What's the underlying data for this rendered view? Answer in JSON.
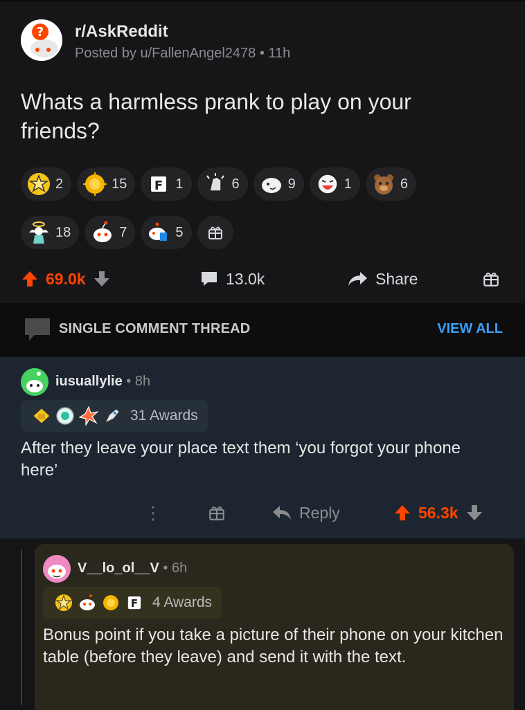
{
  "post": {
    "subreddit": "r/AskReddit",
    "meta": "Posted by u/FallenAngel2478 • 11h",
    "title": "Whats a harmless prank to play on your friends?",
    "awards_row1": [
      {
        "icon": "helpful-star-award-icon",
        "count": "2"
      },
      {
        "icon": "gold-award-icon",
        "count": "15"
      },
      {
        "icon": "press-f-award-icon",
        "count": "1"
      },
      {
        "icon": "clapping-hands-award-icon",
        "count": "6"
      },
      {
        "icon": "face-award-icon",
        "count": "9"
      },
      {
        "icon": "laughing-award-icon",
        "count": "1"
      },
      {
        "icon": "bear-award-icon",
        "count": "6"
      }
    ],
    "awards_row2": [
      {
        "icon": "angel-award-icon",
        "count": "18"
      },
      {
        "icon": "snoo-award-icon",
        "count": "7"
      },
      {
        "icon": "hugs-award-icon",
        "count": "5"
      }
    ],
    "upvotes": "69.0k",
    "comments": "13.0k",
    "share_label": "Share"
  },
  "thread": {
    "title": "SINGLE COMMENT THREAD",
    "view_all": "VIEW ALL"
  },
  "comment1": {
    "user": "iusuallylie",
    "time": " • 8h",
    "awards_label": "31 Awards",
    "body": "After they leave your place text them ‘you forgot your phone here’",
    "more_label": "⋮",
    "reply_label": "Reply",
    "upvotes": "56.3k"
  },
  "comment2": {
    "user": "V__lo_ol__V",
    "time": " • 6h",
    "awards_label": "4 Awards",
    "body": "Bonus point if you take a picture of their phone on your kitchen table (before they leave) and send it with the text."
  },
  "colors": {
    "accent_orange": "#ff4500",
    "link_blue": "#3aa0ff",
    "comment1_bg": "#1d2630",
    "comment2_bg": "#2a271c"
  }
}
